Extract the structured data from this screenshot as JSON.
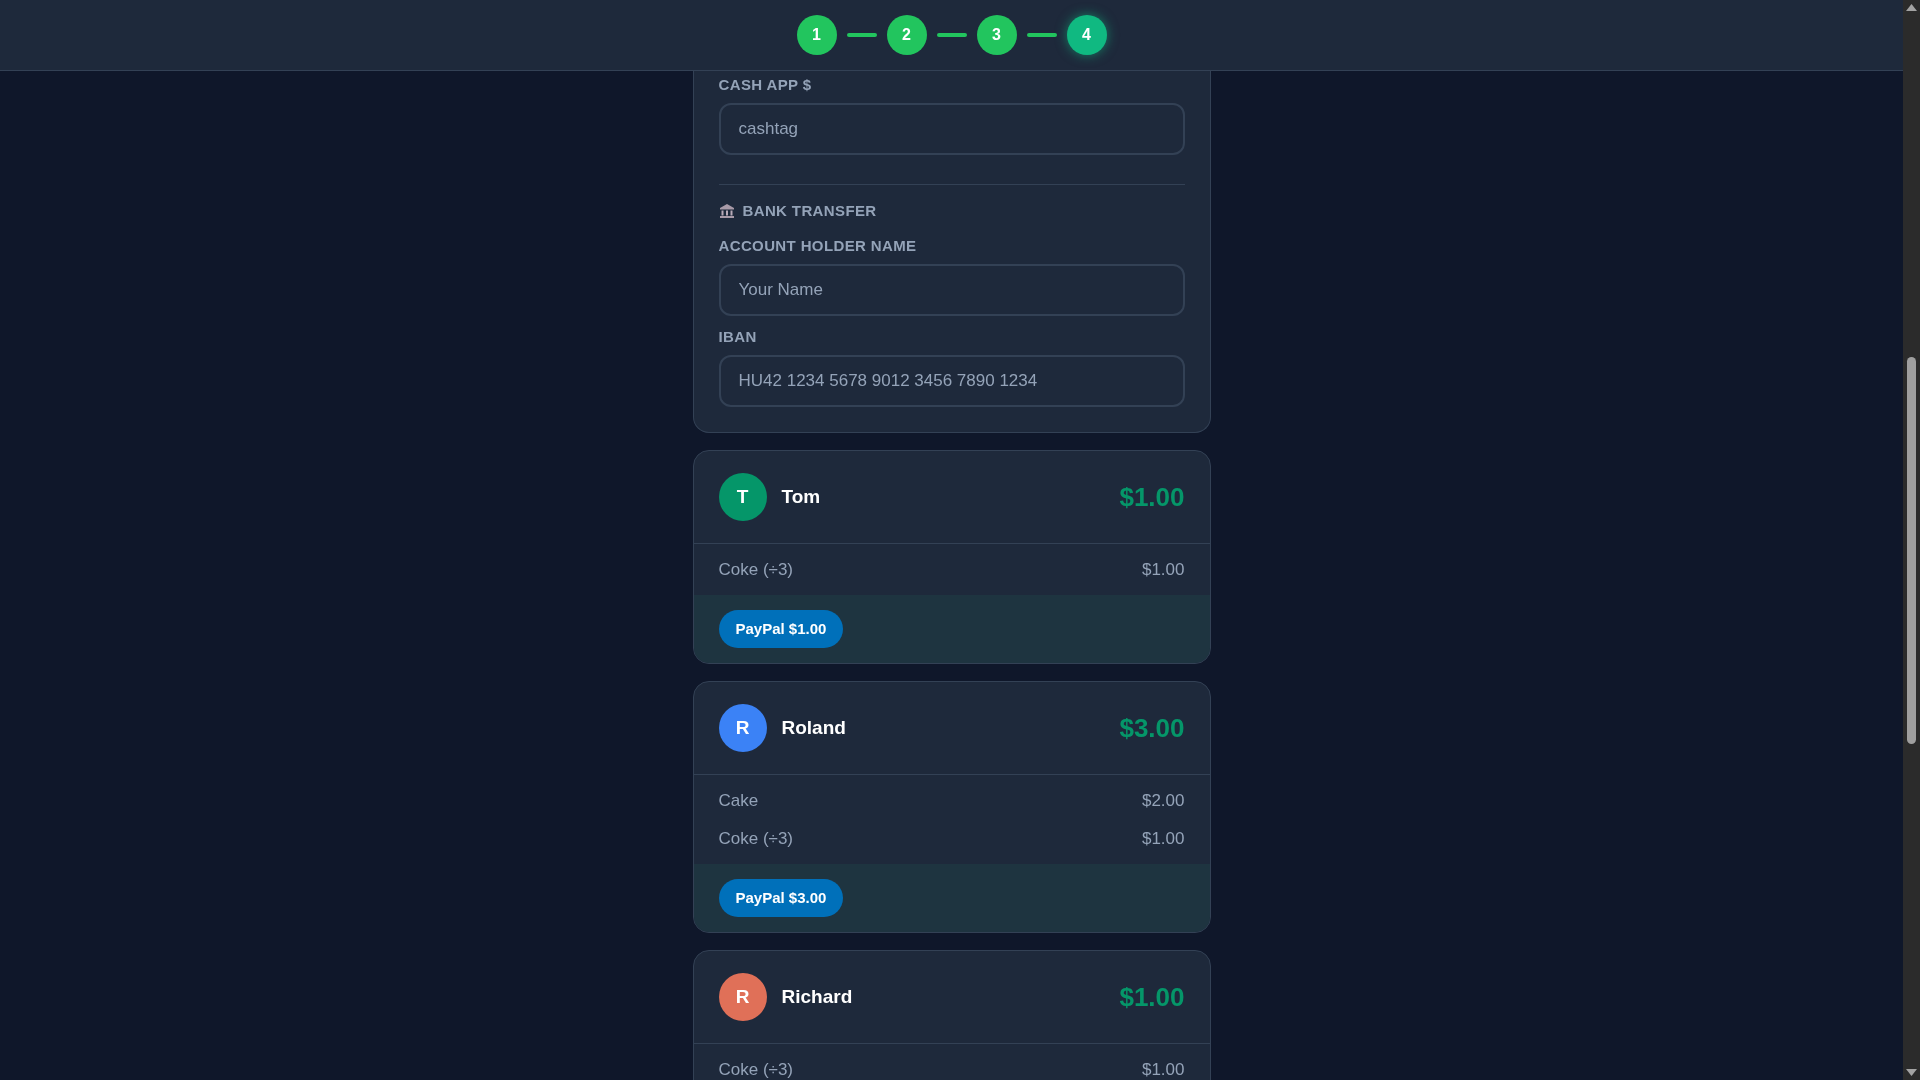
{
  "stepper": [
    {
      "label": "1",
      "selected": false
    },
    {
      "label": "2",
      "selected": false
    },
    {
      "label": "3",
      "selected": false
    },
    {
      "label": "4",
      "selected": true
    }
  ],
  "payment_form": {
    "sections": [
      {
        "fields": [
          {
            "label": "CASH APP $",
            "placeholder": "cashtag"
          }
        ]
      },
      {
        "heading": "BANK TRANSFER",
        "fields": [
          {
            "label": "ACCOUNT HOLDER NAME",
            "placeholder": "Your Name"
          },
          {
            "label": "IBAN",
            "placeholder": "HU42 1234 5678 9012 3456 7890 1234"
          }
        ]
      }
    ]
  },
  "people": [
    {
      "initial": "T",
      "color": "#059669",
      "name": "Tom",
      "total": "$1.00",
      "items": [
        {
          "name": "Coke (÷3)",
          "amount": "$1.00"
        }
      ],
      "pay_button": "PayPal $1.00"
    },
    {
      "initial": "R",
      "color": "#3b82f6",
      "name": "Roland",
      "total": "$3.00",
      "items": [
        {
          "name": "Cake",
          "amount": "$2.00"
        },
        {
          "name": "Coke (÷3)",
          "amount": "$1.00"
        }
      ],
      "pay_button": "PayPal $3.00"
    },
    {
      "initial": "R",
      "color": "#e07058",
      "name": "Richard",
      "total": "$1.00",
      "items": [
        {
          "name": "Coke (÷3)",
          "amount": "$1.00"
        }
      ]
    }
  ]
}
